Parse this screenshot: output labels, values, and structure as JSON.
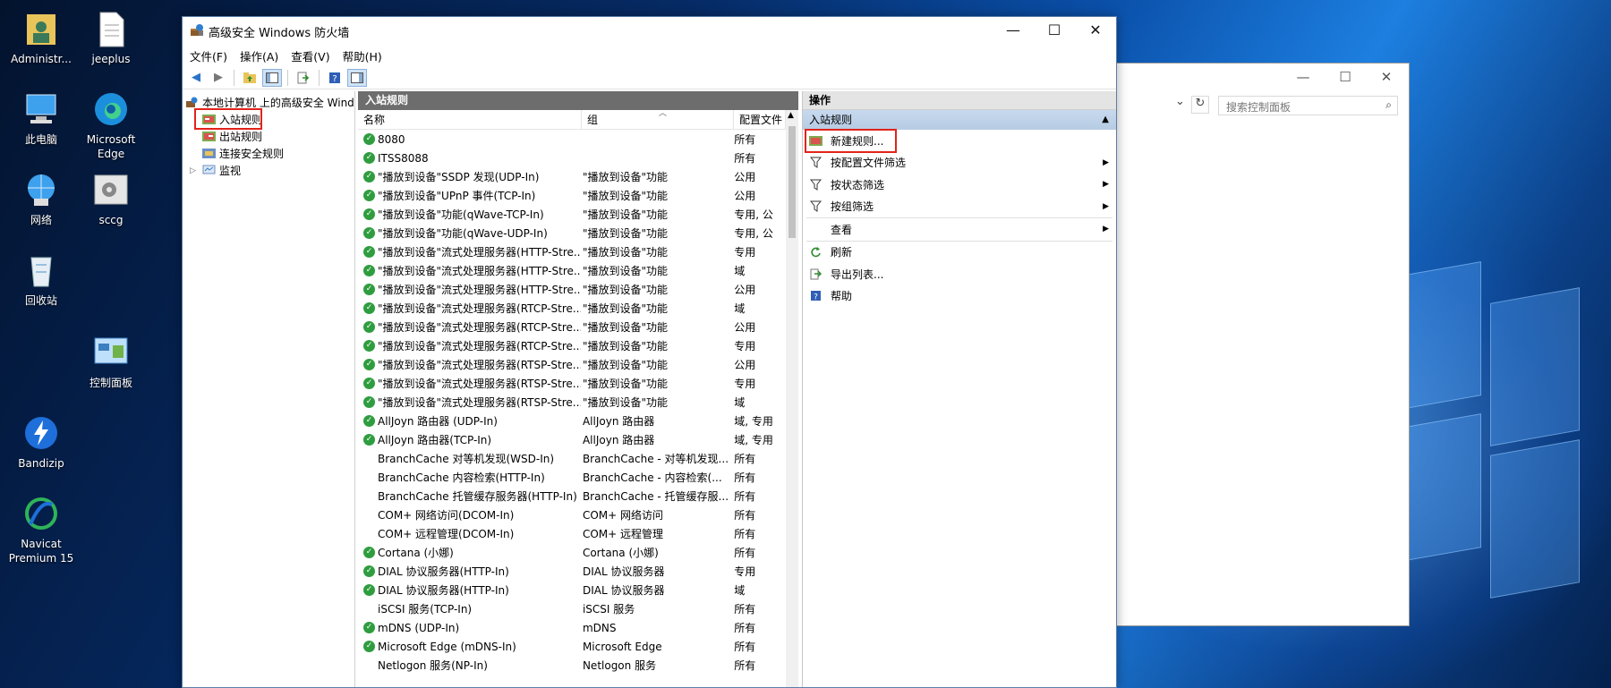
{
  "desktop": {
    "icons": [
      {
        "label": "Administr...",
        "icon": "user-folder-icon"
      },
      {
        "label": "jeeplus",
        "icon": "document-icon"
      },
      {
        "label": "此电脑",
        "icon": "computer-icon"
      },
      {
        "label": "Microsoft Edge",
        "icon": "edge-icon"
      },
      {
        "label": "网络",
        "icon": "network-icon"
      },
      {
        "label": "sccg",
        "icon": "shortcut-icon"
      },
      {
        "label": "回收站",
        "icon": "recycle-bin-icon"
      },
      {
        "label": "控制面板",
        "icon": "control-panel-icon"
      },
      {
        "label": "Bandizip",
        "icon": "bandizip-icon"
      },
      {
        "label": "Navicat Premium 15",
        "icon": "navicat-icon"
      }
    ]
  },
  "control_panel": {
    "search_placeholder": "搜索控制面板",
    "refresh_icon": "↻",
    "dropdown_icon": "⌄"
  },
  "window": {
    "title": "高级安全 Windows 防火墙",
    "menu": [
      "文件(F)",
      "操作(A)",
      "查看(V)",
      "帮助(H)"
    ],
    "tree": {
      "root": "本地计算机 上的高级安全 Wind",
      "items": [
        "入站规则",
        "出站规则",
        "连接安全规则",
        "监视"
      ],
      "selected": "入站规则"
    },
    "middle": {
      "header": "入站规则",
      "columns": [
        "名称",
        "组",
        "配置文件"
      ],
      "rows": [
        {
          "enabled": true,
          "name": "8080",
          "group": "",
          "profile": "所有"
        },
        {
          "enabled": true,
          "name": "ITSS8088",
          "group": "",
          "profile": "所有"
        },
        {
          "enabled": true,
          "name": "\"播放到设备\"SSDP 发现(UDP-In)",
          "group": "\"播放到设备\"功能",
          "profile": "公用"
        },
        {
          "enabled": true,
          "name": "\"播放到设备\"UPnP 事件(TCP-In)",
          "group": "\"播放到设备\"功能",
          "profile": "公用"
        },
        {
          "enabled": true,
          "name": "\"播放到设备\"功能(qWave-TCP-In)",
          "group": "\"播放到设备\"功能",
          "profile": "专用, 公"
        },
        {
          "enabled": true,
          "name": "\"播放到设备\"功能(qWave-UDP-In)",
          "group": "\"播放到设备\"功能",
          "profile": "专用, 公"
        },
        {
          "enabled": true,
          "name": "\"播放到设备\"流式处理服务器(HTTP-Stre...",
          "group": "\"播放到设备\"功能",
          "profile": "专用"
        },
        {
          "enabled": true,
          "name": "\"播放到设备\"流式处理服务器(HTTP-Stre...",
          "group": "\"播放到设备\"功能",
          "profile": "域"
        },
        {
          "enabled": true,
          "name": "\"播放到设备\"流式处理服务器(HTTP-Stre...",
          "group": "\"播放到设备\"功能",
          "profile": "公用"
        },
        {
          "enabled": true,
          "name": "\"播放到设备\"流式处理服务器(RTCP-Stre...",
          "group": "\"播放到设备\"功能",
          "profile": "域"
        },
        {
          "enabled": true,
          "name": "\"播放到设备\"流式处理服务器(RTCP-Stre...",
          "group": "\"播放到设备\"功能",
          "profile": "公用"
        },
        {
          "enabled": true,
          "name": "\"播放到设备\"流式处理服务器(RTCP-Stre...",
          "group": "\"播放到设备\"功能",
          "profile": "专用"
        },
        {
          "enabled": true,
          "name": "\"播放到设备\"流式处理服务器(RTSP-Stre...",
          "group": "\"播放到设备\"功能",
          "profile": "公用"
        },
        {
          "enabled": true,
          "name": "\"播放到设备\"流式处理服务器(RTSP-Stre...",
          "group": "\"播放到设备\"功能",
          "profile": "专用"
        },
        {
          "enabled": true,
          "name": "\"播放到设备\"流式处理服务器(RTSP-Stre...",
          "group": "\"播放到设备\"功能",
          "profile": "域"
        },
        {
          "enabled": true,
          "name": "AllJoyn 路由器 (UDP-In)",
          "group": "AllJoyn 路由器",
          "profile": "域, 专用"
        },
        {
          "enabled": true,
          "name": "AllJoyn 路由器(TCP-In)",
          "group": "AllJoyn 路由器",
          "profile": "域, 专用"
        },
        {
          "enabled": false,
          "name": "BranchCache 对等机发现(WSD-In)",
          "group": "BranchCache - 对等机发现...",
          "profile": "所有"
        },
        {
          "enabled": false,
          "name": "BranchCache 内容检索(HTTP-In)",
          "group": "BranchCache - 内容检索(...",
          "profile": "所有"
        },
        {
          "enabled": false,
          "name": "BranchCache 托管缓存服务器(HTTP-In)",
          "group": "BranchCache - 托管缓存服...",
          "profile": "所有"
        },
        {
          "enabled": false,
          "name": "COM+ 网络访问(DCOM-In)",
          "group": "COM+ 网络访问",
          "profile": "所有"
        },
        {
          "enabled": false,
          "name": "COM+ 远程管理(DCOM-In)",
          "group": "COM+ 远程管理",
          "profile": "所有"
        },
        {
          "enabled": true,
          "name": "Cortana (小娜)",
          "group": "Cortana (小娜)",
          "profile": "所有"
        },
        {
          "enabled": true,
          "name": "DIAL 协议服务器(HTTP-In)",
          "group": "DIAL 协议服务器",
          "profile": "专用"
        },
        {
          "enabled": true,
          "name": "DIAL 协议服务器(HTTP-In)",
          "group": "DIAL 协议服务器",
          "profile": "域"
        },
        {
          "enabled": false,
          "name": "iSCSI 服务(TCP-In)",
          "group": "iSCSI 服务",
          "profile": "所有"
        },
        {
          "enabled": true,
          "name": "mDNS (UDP-In)",
          "group": "mDNS",
          "profile": "所有"
        },
        {
          "enabled": true,
          "name": "Microsoft Edge (mDNS-In)",
          "group": "Microsoft Edge",
          "profile": "所有"
        },
        {
          "enabled": false,
          "name": "Netlogon 服务(NP-In)",
          "group": "Netlogon 服务",
          "profile": "所有"
        }
      ]
    },
    "actions": {
      "header": "操作",
      "section": "入站规则",
      "items": [
        {
          "label": "新建规则...",
          "icon": "new-rule-icon",
          "submenu": false,
          "highlighted": true
        },
        {
          "label": "按配置文件筛选",
          "icon": "filter-icon",
          "submenu": true
        },
        {
          "label": "按状态筛选",
          "icon": "filter-icon",
          "submenu": true
        },
        {
          "label": "按组筛选",
          "icon": "filter-icon",
          "submenu": true
        },
        {
          "label": "查看",
          "icon": "",
          "submenu": true
        },
        {
          "label": "刷新",
          "icon": "refresh-icon",
          "submenu": false
        },
        {
          "label": "导出列表...",
          "icon": "export-icon",
          "submenu": false
        },
        {
          "label": "帮助",
          "icon": "help-icon",
          "submenu": false
        }
      ]
    }
  },
  "colors": {
    "highlight_red": "#e2231a",
    "enabled_green": "#2f9d3f",
    "pane_header": "#6d6d6d",
    "section_blue": "#c7d9ee"
  }
}
